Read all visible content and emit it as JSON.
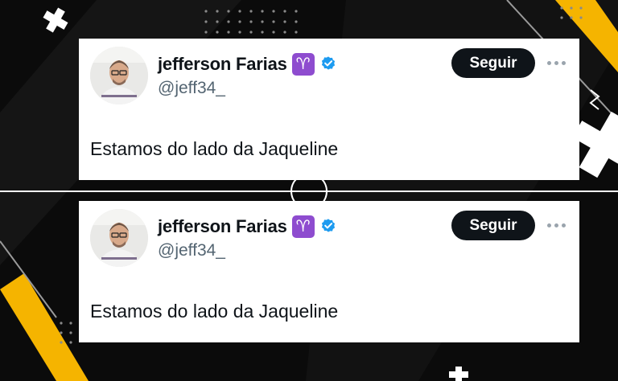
{
  "tweets": [
    {
      "display_name": "jefferson Farias",
      "zodiac_emoji": "♈",
      "handle": "@jeff34_",
      "follow_label": "Seguir",
      "text": "Estamos do lado da Jaqueline"
    },
    {
      "display_name": "jefferson Farias",
      "zodiac_emoji": "♈",
      "handle": "@jeff34_",
      "follow_label": "Seguir",
      "text": "Estamos do lado da Jaqueline"
    }
  ],
  "colors": {
    "background": "#0b0b0b",
    "accent_yellow": "#f5b400",
    "follow_button": "#0f1419",
    "verified_blue": "#1d9bf0",
    "zodiac_purple": "#8e4ccf",
    "handle_gray": "#536471"
  },
  "icons": [
    "avatar",
    "zodiac-aries-icon",
    "verified-badge-icon",
    "more-options-icon"
  ]
}
